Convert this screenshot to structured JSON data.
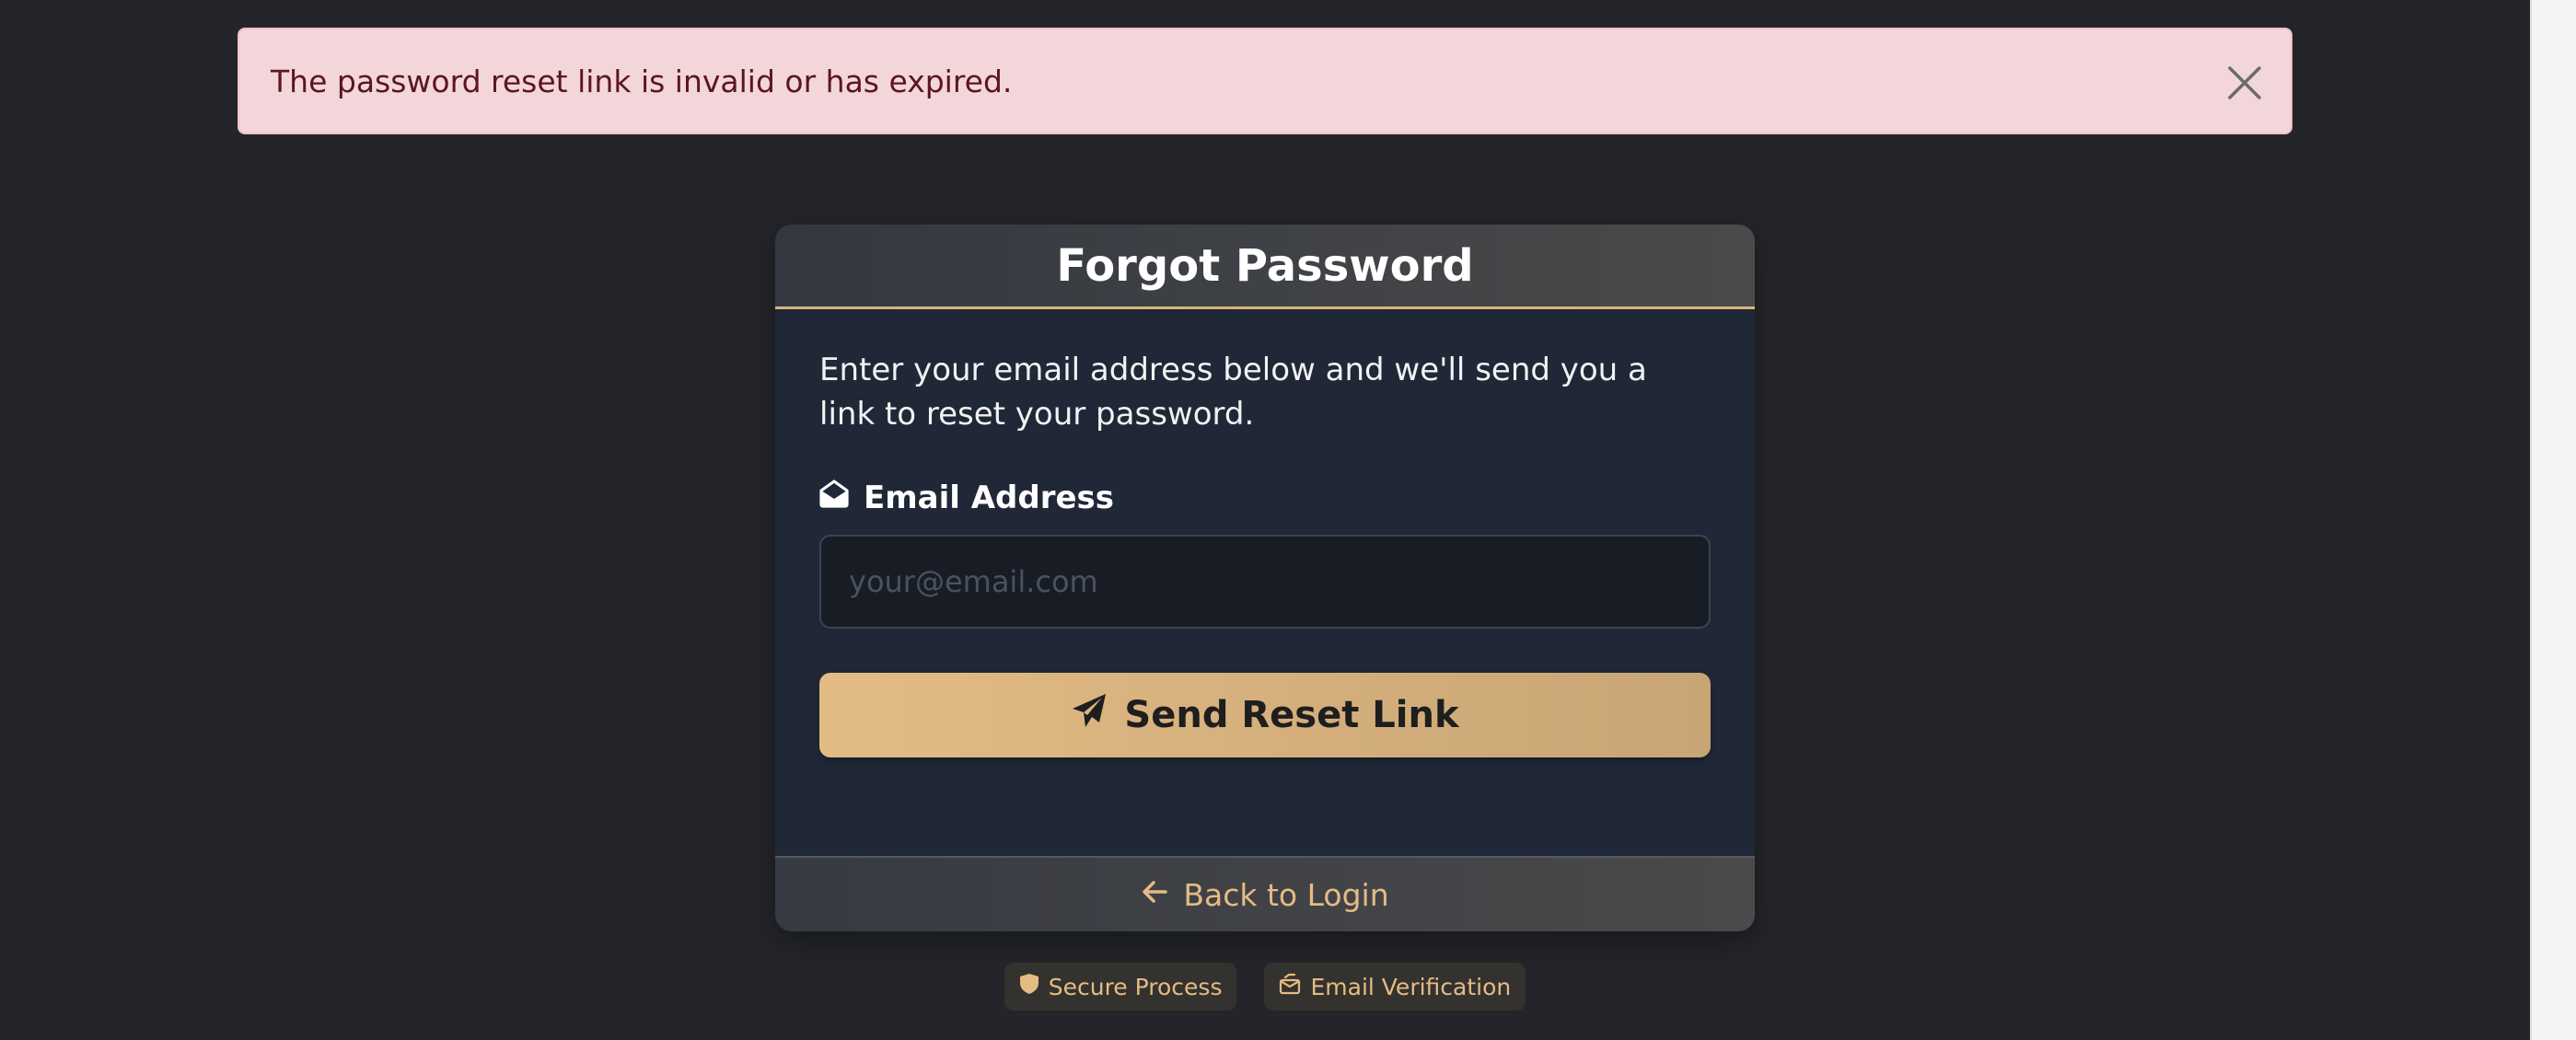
{
  "alert": {
    "message": "The password reset link is invalid or has expired.",
    "close_icon": "close-icon"
  },
  "card": {
    "title": "Forgot Password",
    "intro": "Enter your email address below and we'll send you a link to reset your password.",
    "email": {
      "label": "Email Address",
      "icon": "envelope-open-icon",
      "placeholder": "your@email.com",
      "value": ""
    },
    "send_button": {
      "label": "Send Reset Link",
      "icon": "paper-plane-icon"
    },
    "footer": {
      "label": "Back to Login",
      "icon": "arrow-left-icon"
    }
  },
  "badges": [
    {
      "label": "Secure Process",
      "icon": "shield-icon"
    },
    {
      "label": "Email Verification",
      "icon": "envelope-check-icon"
    }
  ],
  "colors": {
    "background": "#23252a",
    "card": "#202838",
    "accent": "#e4bb84",
    "alert_bg": "#f3d6d9",
    "alert_text": "#5b1620"
  }
}
